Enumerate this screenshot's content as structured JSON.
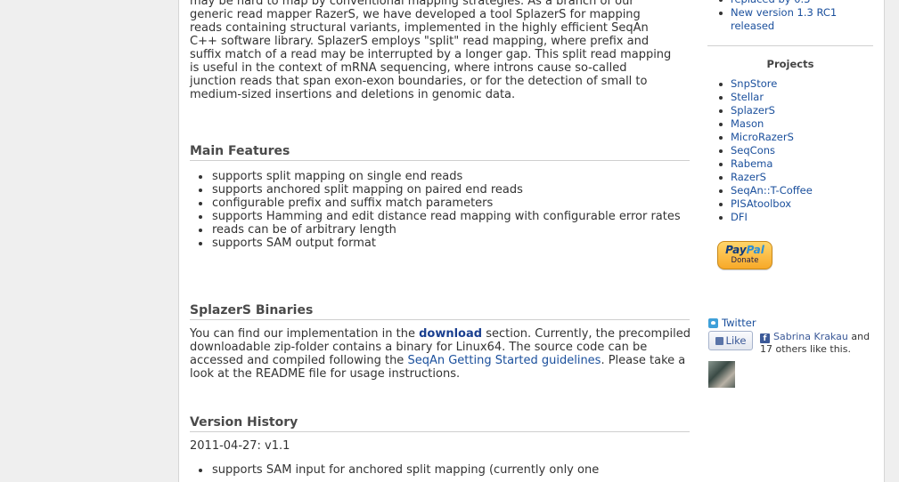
{
  "intro_lines": [
    "may be hard to map by conventional mapping strategies. As a branch of our",
    "generic read mapper RazerS, we have developed a tool SplazerS for mapping",
    "reads containing structural variants, implemented in the highly efficient SeqAn",
    "C++ software library. SplazerS employs \"split\" read mapping, where prefix and",
    "suffix match of a read may be interrupted by a longer gap. This split read mapping",
    "is useful in the context of mRNA sequencing, where introns cause so-called",
    "junction reads that span exon-exon boundaries, or for the detection of small to",
    "medium-sized insertions and deletions in genomic data."
  ],
  "features": {
    "heading": "Main Features",
    "items": [
      "supports split mapping on single end reads",
      "supports anchored split mapping on paired end reads",
      "configurable prefix and suffix match parameters",
      "supports Hamming and edit distance read mapping with configurable error rates",
      "reads can be of arbitrary length",
      "supports SAM output format"
    ]
  },
  "binaries": {
    "heading": "SplazerS Binaries",
    "text_1": "You can find our implementation in the ",
    "link_download": "download",
    "text_2": " section. Currently, the precompiled downloadable zip-folder contains a binary for Linux64. The source code can be accessed and compiled following the ",
    "link_guidelines": "SeqAn Getting Started guidelines",
    "text_3": ". Please take a look at the README file for usage instructions."
  },
  "history": {
    "heading": "Version History",
    "version_line": "2011-04-27: v1.1",
    "items": [
      "supports SAM input for anchored split mapping (currently only one"
    ]
  },
  "sidebar": {
    "news_items": [
      "replaced by 0.3",
      "New version 1.3 RC1 released"
    ],
    "projects_heading": "Projects",
    "projects": [
      "SnpStore",
      "Stellar",
      "SplazerS",
      "Mason",
      "MicroRazerS",
      "SeqCons",
      "Rabema",
      "RazerS",
      "SeqAn::T-Coffee",
      "PISAtoolbox",
      "DFI"
    ],
    "paypal_brand_1": "Pay",
    "paypal_brand_2": "Pal",
    "paypal_donate": "Donate",
    "twitter_label": "Twitter",
    "like_label": "Like",
    "fb_name": "Sabrina Krakau",
    "fb_rest": " and 17 others like this."
  }
}
